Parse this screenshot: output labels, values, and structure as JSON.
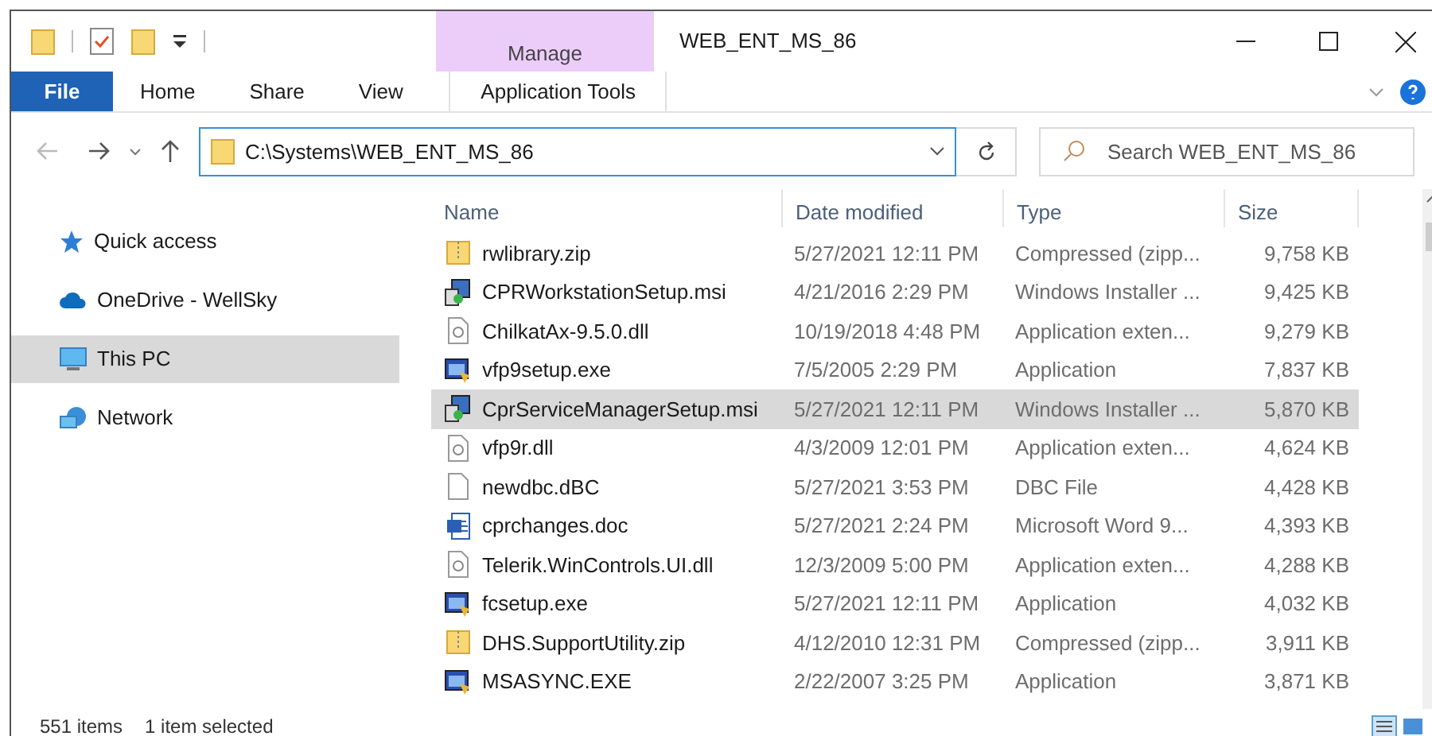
{
  "window": {
    "title": "WEB_ENT_MS_86",
    "context_tab": {
      "label": "Manage"
    }
  },
  "ribbon_tabs": [
    {
      "label": "File",
      "selected": true,
      "kind": "file"
    },
    {
      "label": "Home",
      "selected": false,
      "kind": "tab"
    },
    {
      "label": "Share",
      "selected": false,
      "kind": "tab"
    },
    {
      "label": "View",
      "selected": false,
      "kind": "tab"
    },
    {
      "label": "Application Tools",
      "selected": false,
      "kind": "context"
    }
  ],
  "address_bar": {
    "value": "C:\\Systems\\WEB_ENT_MS_86"
  },
  "search": {
    "placeholder": "Search WEB_ENT_MS_86"
  },
  "sidebar": {
    "items": [
      {
        "label": "Quick access",
        "kind": "star",
        "selected": false
      },
      {
        "label": "OneDrive - WellSky",
        "kind": "cloud",
        "selected": false
      },
      {
        "label": "This PC",
        "kind": "pc",
        "selected": true
      },
      {
        "label": "Network",
        "kind": "network",
        "selected": false
      }
    ]
  },
  "table": {
    "columns": [
      "Name",
      "Date modified",
      "Type",
      "Size"
    ],
    "rows": [
      {
        "name": "rwlibrary.zip",
        "date": "5/27/2021 12:11 PM",
        "type": "Compressed (zipp...",
        "size": "9,758 KB",
        "kind": "zip",
        "selected": false
      },
      {
        "name": "CPRWorkstationSetup.msi",
        "date": "4/21/2016 2:29 PM",
        "type": "Windows Installer ...",
        "size": "9,425 KB",
        "kind": "msi",
        "selected": false
      },
      {
        "name": "ChilkatAx-9.5.0.dll",
        "date": "10/19/2018 4:48 PM",
        "type": "Application exten...",
        "size": "9,279 KB",
        "kind": "dll",
        "selected": false
      },
      {
        "name": "vfp9setup.exe",
        "date": "7/5/2005 2:29 PM",
        "type": "Application",
        "size": "7,837 KB",
        "kind": "exe",
        "selected": false
      },
      {
        "name": "CprServiceManagerSetup.msi",
        "date": "5/27/2021 12:11 PM",
        "type": "Windows Installer ...",
        "size": "5,870 KB",
        "kind": "msi",
        "selected": true
      },
      {
        "name": "vfp9r.dll",
        "date": "4/3/2009 12:01 PM",
        "type": "Application exten...",
        "size": "4,624 KB",
        "kind": "dll",
        "selected": false
      },
      {
        "name": "newdbc.dBC",
        "date": "5/27/2021 3:53 PM",
        "type": "DBC File",
        "size": "4,428 KB",
        "kind": "file",
        "selected": false
      },
      {
        "name": "cprchanges.doc",
        "date": "5/27/2021 2:24 PM",
        "type": "Microsoft Word 9...",
        "size": "4,393 KB",
        "kind": "doc",
        "selected": false
      },
      {
        "name": "Telerik.WinControls.UI.dll",
        "date": "12/3/2009 5:00 PM",
        "type": "Application exten...",
        "size": "4,288 KB",
        "kind": "dll",
        "selected": false
      },
      {
        "name": "fcsetup.exe",
        "date": "5/27/2021 12:11 PM",
        "type": "Application",
        "size": "4,032 KB",
        "kind": "exe",
        "selected": false
      },
      {
        "name": "DHS.SupportUtility.zip",
        "date": "4/12/2010 12:31 PM",
        "type": "Compressed (zipp...",
        "size": "3,911 KB",
        "kind": "zip",
        "selected": false
      },
      {
        "name": "MSASYNC.EXE",
        "date": "2/22/2007 3:25 PM",
        "type": "Application",
        "size": "3,871 KB",
        "kind": "exe",
        "selected": false
      }
    ]
  },
  "status_bar": {
    "items": [
      "551 items",
      "1 item selected"
    ]
  }
}
